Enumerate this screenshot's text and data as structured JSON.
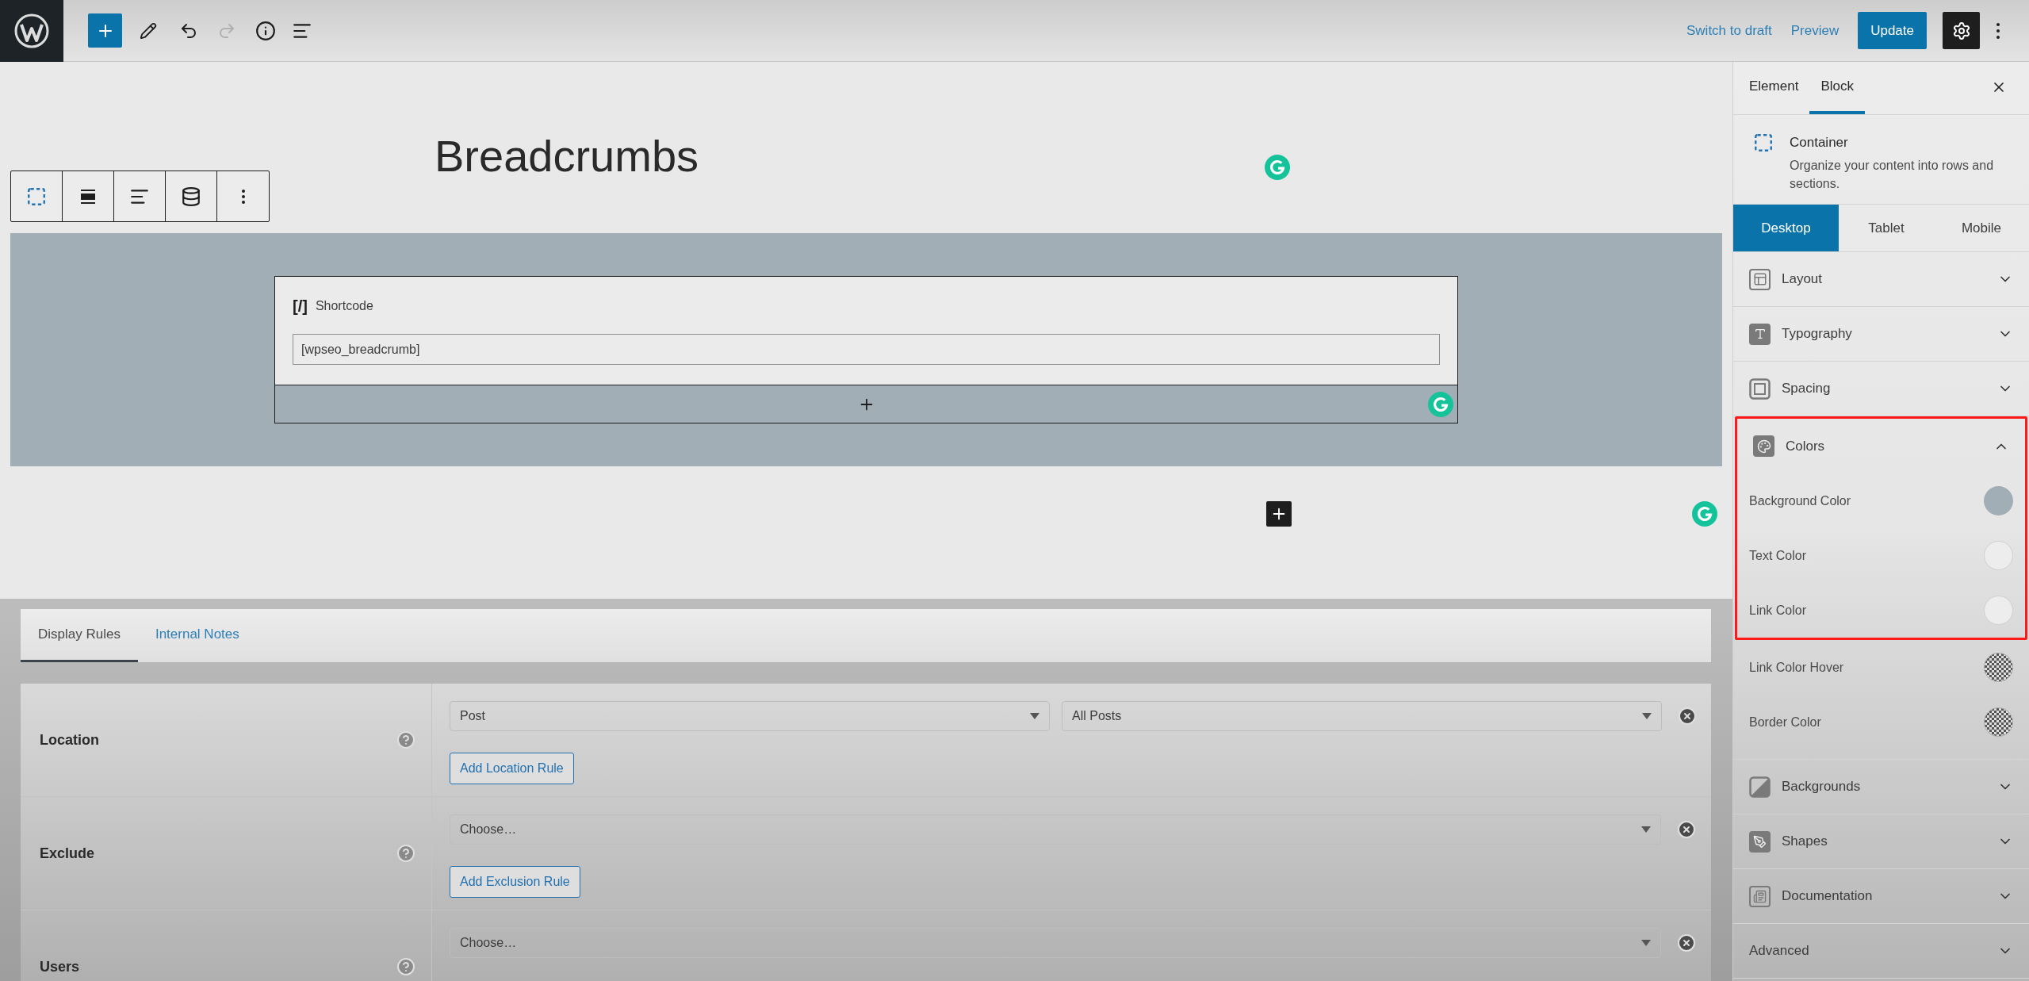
{
  "top_bar": {
    "undo": {
      "disabled": false
    },
    "redo": {
      "disabled": true
    },
    "links": [
      {
        "label": "Switch to draft"
      },
      {
        "label": "Preview"
      }
    ],
    "update_button": "Update",
    "settings": {
      "selected": true
    }
  },
  "post_title": "Breadcrumbs",
  "shortcode_block": {
    "icon_text": "[/]",
    "label": "Shortcode",
    "value": "[wpseo_breadcrumb]"
  },
  "metabox": {
    "tabs": [
      {
        "label": "Display Rules",
        "selected": true
      },
      {
        "label": "Internal Notes",
        "selected": false
      }
    ],
    "rules": [
      {
        "label": "Location",
        "selects": [
          "Post",
          "All Posts"
        ],
        "button": "Add Location Rule"
      },
      {
        "label": "Exclude",
        "selects": [
          "Choose…"
        ],
        "button": "Add Exclusion Rule"
      },
      {
        "label": "Users",
        "selects": [
          "Choose…"
        ]
      }
    ]
  },
  "sidebar": {
    "tabs": [
      {
        "label": "Element",
        "selected": false
      },
      {
        "label": "Block",
        "selected": true
      }
    ],
    "block": {
      "name": "Container",
      "description": "Organize your content into rows and sections."
    },
    "devices": [
      {
        "label": "Desktop",
        "selected": true
      },
      {
        "label": "Tablet",
        "selected": false
      },
      {
        "label": "Mobile",
        "selected": false
      }
    ],
    "sections": [
      {
        "label": "Layout",
        "expanded": false
      },
      {
        "label": "Typography",
        "expanded": false
      },
      {
        "label": "Spacing",
        "expanded": false
      },
      {
        "label": "Colors",
        "expanded": true,
        "highlighted": true,
        "options": [
          {
            "label": "Background Color",
            "kind": "solid",
            "color": "#a1aeb6",
            "highlighted": true
          },
          {
            "label": "Text Color",
            "kind": "empty",
            "highlighted": true
          },
          {
            "label": "Link Color",
            "kind": "empty",
            "highlighted": true
          },
          {
            "label": "Link Color Hover",
            "kind": "transparent",
            "highlighted": false
          },
          {
            "label": "Border Color",
            "kind": "transparent",
            "highlighted": false
          }
        ]
      },
      {
        "label": "Backgrounds",
        "expanded": false
      },
      {
        "label": "Shapes",
        "expanded": false
      },
      {
        "label": "Documentation",
        "expanded": false
      },
      {
        "label": "Advanced",
        "expanded": false
      }
    ]
  }
}
